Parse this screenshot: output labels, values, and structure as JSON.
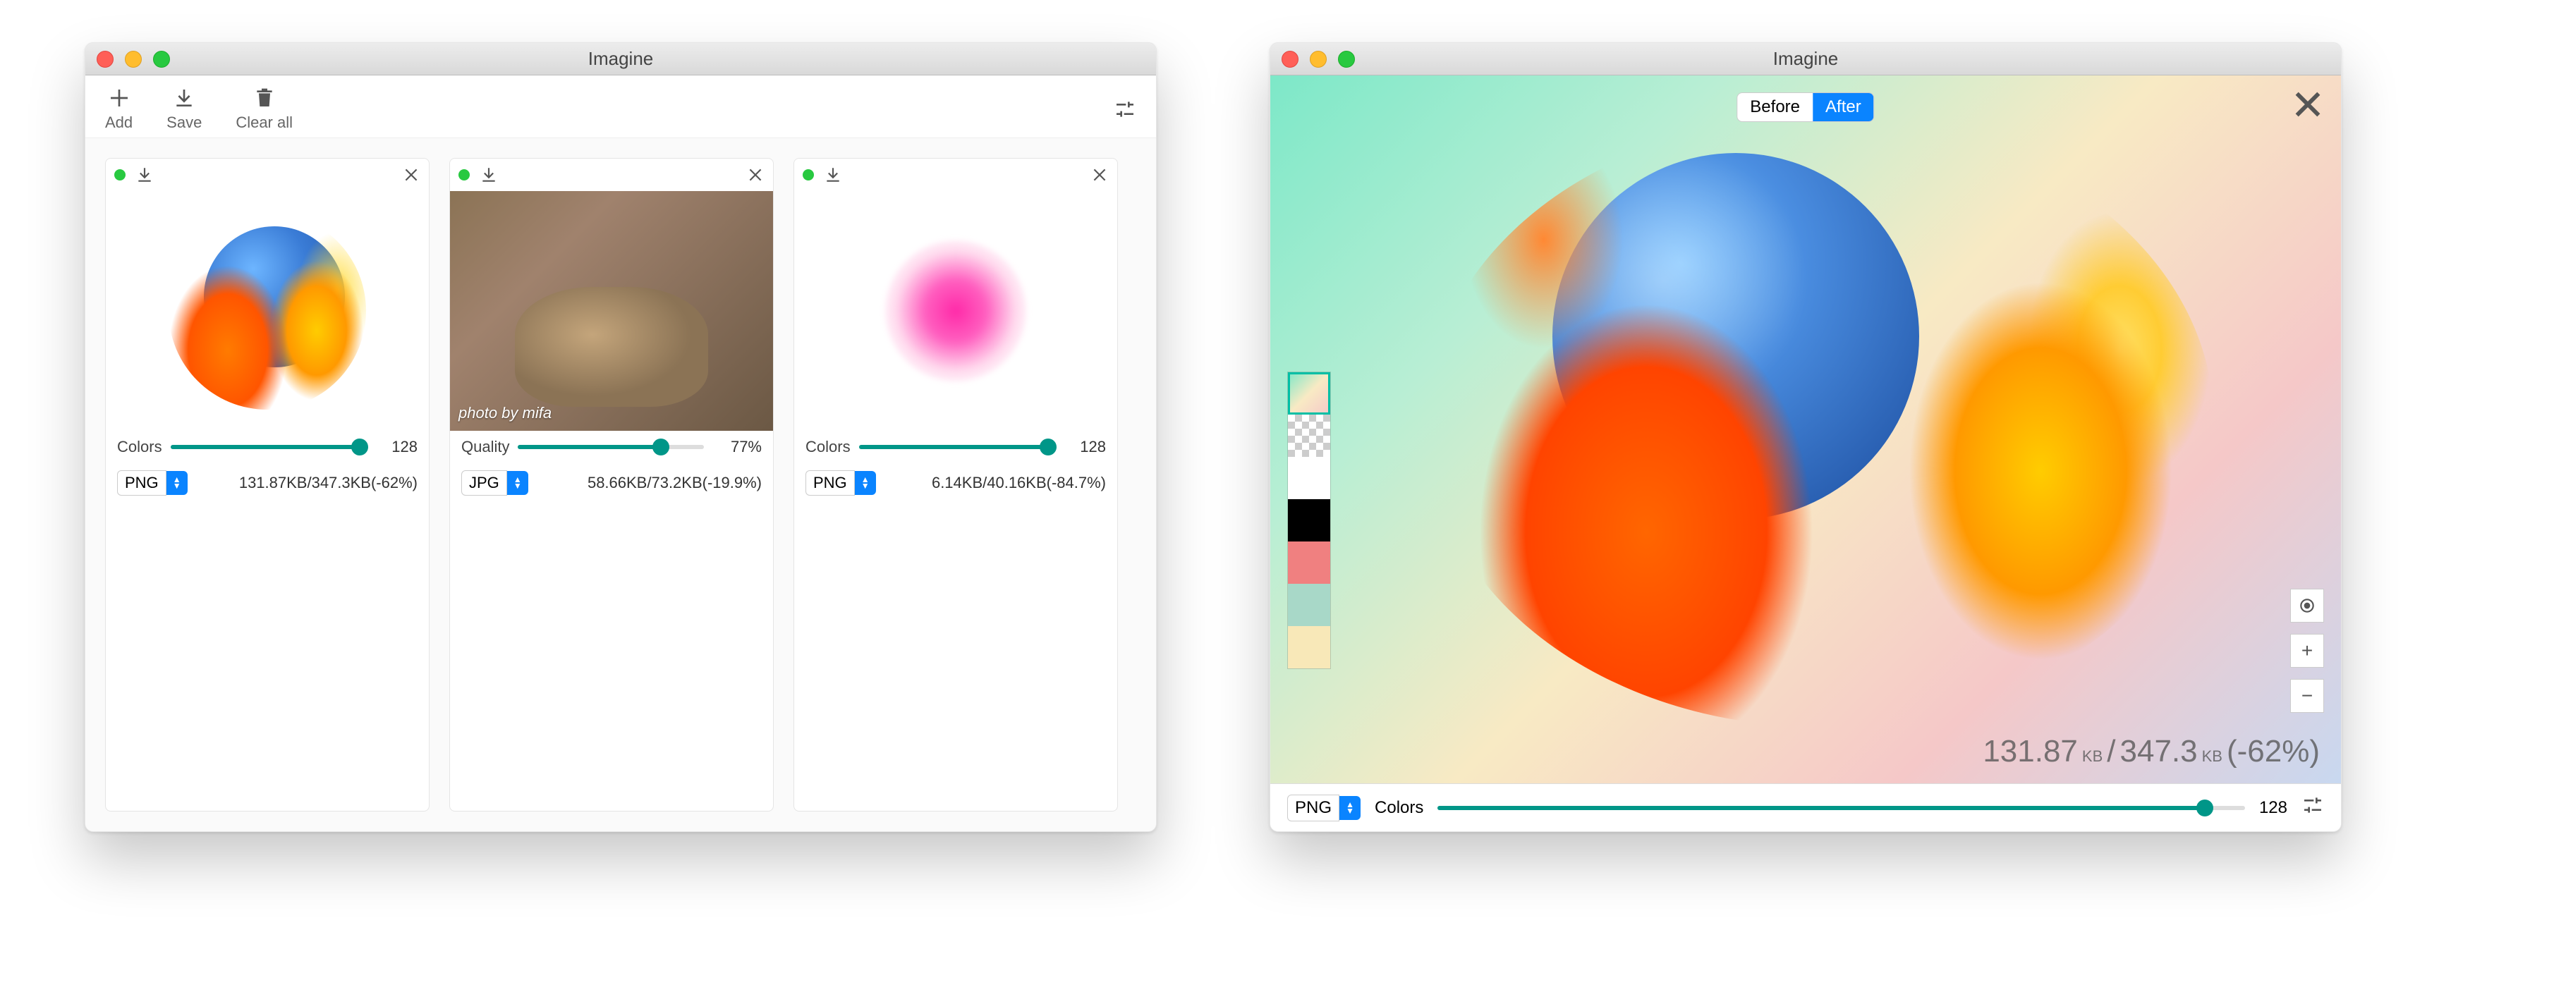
{
  "app": {
    "title": "Imagine"
  },
  "toolbar": {
    "add": "Add",
    "save": "Save",
    "clear_all": "Clear all"
  },
  "cards": [
    {
      "slider_label": "Colors",
      "slider_value": "128",
      "slider_pct": 100,
      "format": "PNG",
      "stats": "131.87KB/347.3KB(-62%)"
    },
    {
      "slider_label": "Quality",
      "slider_value": "77%",
      "slider_pct": 77,
      "format": "JPG",
      "stats": "58.66KB/73.2KB(-19.9%)",
      "credit": "photo by mifa"
    },
    {
      "slider_label": "Colors",
      "slider_value": "128",
      "slider_pct": 100,
      "format": "PNG",
      "stats": "6.14KB/40.16KB(-84.7%)"
    }
  ],
  "preview": {
    "toggle_before": "Before",
    "toggle_after": "After",
    "stats_new": "131.87",
    "stats_new_unit": "KB",
    "stats_sep": "/",
    "stats_orig": "347.3",
    "stats_orig_unit": "KB",
    "stats_delta": "(-62%)",
    "format": "PNG",
    "slider_label": "Colors",
    "slider_value": "128",
    "slider_pct": 95,
    "swatches": [
      "gradient",
      "transparent",
      "#ffffff",
      "#000000",
      "#f08080",
      "#a8d8c8",
      "#f8e8b8"
    ]
  }
}
